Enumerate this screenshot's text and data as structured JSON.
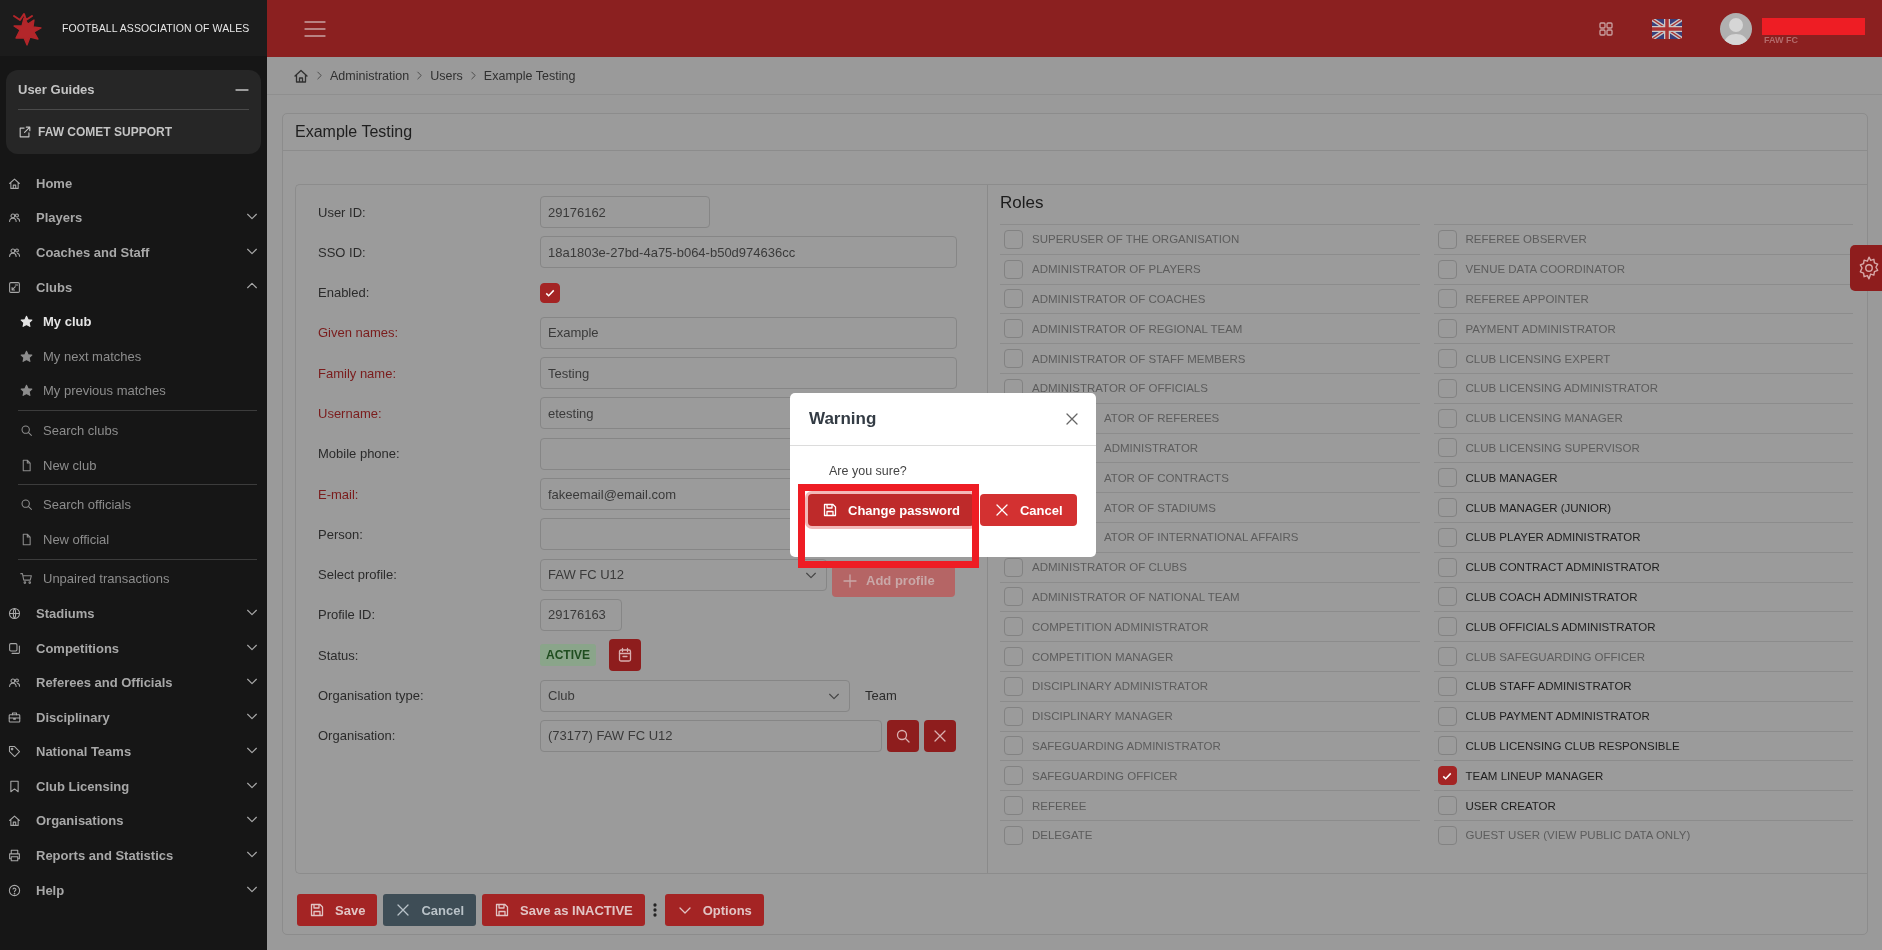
{
  "brand": {
    "name": "FOOTBALL ASSOCIATION OF WALES"
  },
  "header": {
    "org": "FAW FC"
  },
  "sidebar": {
    "guides": {
      "title": "User Guides",
      "link": "FAW COMET SUPPORT",
      "expanded": true
    },
    "items": [
      {
        "label": "Home",
        "kind": "link"
      },
      {
        "label": "Players",
        "kind": "group",
        "expanded": false
      },
      {
        "label": "Coaches and Staff",
        "kind": "group",
        "expanded": false
      },
      {
        "label": "Clubs",
        "kind": "group",
        "expanded": true,
        "children": [
          {
            "items": [
              {
                "label": "My club",
                "selected": true
              },
              {
                "label": "My next matches",
                "selected": false
              },
              {
                "label": "My previous matches",
                "selected": false
              }
            ]
          },
          {
            "items": [
              {
                "label": "Search clubs",
                "selected": false
              },
              {
                "label": "New club",
                "selected": false
              }
            ]
          },
          {
            "items": [
              {
                "label": "Search officials",
                "selected": false
              },
              {
                "label": "New official",
                "selected": false
              }
            ]
          },
          {
            "items": [
              {
                "label": "Unpaired transactions",
                "selected": false
              }
            ]
          }
        ]
      },
      {
        "label": "Stadiums",
        "kind": "group",
        "expanded": false
      },
      {
        "label": "Competitions",
        "kind": "group",
        "expanded": false
      },
      {
        "label": "Referees and Officials",
        "kind": "group",
        "expanded": false
      },
      {
        "label": "Disciplinary",
        "kind": "group",
        "expanded": false
      },
      {
        "label": "National Teams",
        "kind": "group",
        "expanded": false
      },
      {
        "label": "Club Licensing",
        "kind": "group",
        "expanded": false
      },
      {
        "label": "Organisations",
        "kind": "group",
        "expanded": false
      },
      {
        "label": "Reports and Statistics",
        "kind": "group",
        "expanded": false
      },
      {
        "label": "Help",
        "kind": "group",
        "expanded": false
      }
    ]
  },
  "breadcrumb": [
    "Administration",
    "Users",
    "Example Testing"
  ],
  "page": {
    "title": "Example Testing"
  },
  "form": {
    "fields": [
      {
        "label": "User ID:",
        "kind": "short",
        "required": false,
        "value": "29176162"
      },
      {
        "label": "SSO ID:",
        "kind": "text",
        "required": false,
        "value": "18a1803e-27bd-4a75-b064-b50d974636cc"
      },
      {
        "label": "Enabled:",
        "kind": "checkbox",
        "required": false,
        "checked": true
      },
      {
        "label": "Given names:",
        "kind": "text",
        "required": true,
        "value": "Example"
      },
      {
        "label": "Family name:",
        "kind": "text",
        "required": true,
        "value": "Testing"
      },
      {
        "label": "Username:",
        "kind": "text",
        "required": true,
        "value": "etesting"
      },
      {
        "label": "Mobile phone:",
        "kind": "text",
        "required": false
      },
      {
        "label": "E-mail:",
        "kind": "text",
        "required": true,
        "value": "fakeemail@email.com"
      },
      {
        "label": "Person:",
        "kind": "text",
        "required": false
      },
      {
        "label": "Select profile:",
        "kind": "profile",
        "required": false,
        "value": "FAW FC U12",
        "button": "Add profile"
      },
      {
        "label": "Profile ID:",
        "kind": "short",
        "required": false,
        "value": "29176163"
      },
      {
        "label": "Status:",
        "kind": "status",
        "required": false,
        "value": "ACTIVE"
      },
      {
        "label": "Organisation type:",
        "kind": "select",
        "required": false,
        "value": "Club",
        "aside": "Team"
      },
      {
        "label": "Organisation:",
        "kind": "lookup",
        "required": false,
        "value": "(73177) FAW FC U12"
      }
    ]
  },
  "roles": {
    "title": "Roles",
    "columns": [
      [
        {
          "label": "SUPERUSER OF THE ORGANISATION",
          "kind": "full",
          "checked": false,
          "disabled": true
        },
        {
          "label": "ADMINISTRATOR OF PLAYERS",
          "kind": "full",
          "checked": false,
          "disabled": true
        },
        {
          "label": "ADMINISTRATOR OF COACHES",
          "kind": "full",
          "checked": false,
          "disabled": true
        },
        {
          "label": "ADMINISTRATOR OF REGIONAL TEAM",
          "kind": "full",
          "checked": false,
          "disabled": true
        },
        {
          "label": "ADMINISTRATOR OF STAFF MEMBERS",
          "kind": "full",
          "checked": false,
          "disabled": true
        },
        {
          "label": "ADMINISTRATOR OF OFFICIALS",
          "kind": "full",
          "checked": false,
          "disabled": true
        },
        {
          "label": "ATOR OF REFEREES",
          "kind": "covered",
          "disabled": true
        },
        {
          "label": "ADMINISTRATOR",
          "kind": "covered",
          "disabled": true
        },
        {
          "label": "ATOR OF CONTRACTS",
          "kind": "covered",
          "disabled": true
        },
        {
          "label": "ATOR OF STADIUMS",
          "kind": "covered",
          "disabled": true
        },
        {
          "label": "ATOR OF INTERNATIONAL AFFAIRS",
          "kind": "covered",
          "disabled": true
        },
        {
          "label": "ADMINISTRATOR OF CLUBS",
          "kind": "full",
          "checked": false,
          "disabled": true
        },
        {
          "label": "ADMINISTRATOR OF NATIONAL TEAM",
          "kind": "full",
          "checked": false,
          "disabled": true
        },
        {
          "label": "COMPETITION ADMINISTRATOR",
          "kind": "full",
          "checked": false,
          "disabled": true
        },
        {
          "label": "COMPETITION MANAGER",
          "kind": "full",
          "checked": false,
          "disabled": true
        },
        {
          "label": "DISCIPLINARY ADMINISTRATOR",
          "kind": "full",
          "checked": false,
          "disabled": true
        },
        {
          "label": "DISCIPLINARY MANAGER",
          "kind": "full",
          "checked": false,
          "disabled": true
        },
        {
          "label": "SAFEGUARDING ADMINISTRATOR",
          "kind": "full",
          "checked": false,
          "disabled": true
        },
        {
          "label": "SAFEGUARDING OFFICER",
          "kind": "full",
          "checked": false,
          "disabled": true
        },
        {
          "label": "REFEREE",
          "kind": "full",
          "checked": false,
          "disabled": true
        },
        {
          "label": "DELEGATE",
          "kind": "full",
          "checked": false,
          "disabled": true
        }
      ],
      [
        {
          "label": "REFEREE OBSERVER",
          "kind": "full",
          "checked": false,
          "disabled": true
        },
        {
          "label": "VENUE DATA COORDINATOR",
          "kind": "full",
          "checked": false,
          "disabled": true
        },
        {
          "label": "REFEREE APPOINTER",
          "kind": "full",
          "checked": false,
          "disabled": true
        },
        {
          "label": "PAYMENT ADMINISTRATOR",
          "kind": "full",
          "checked": false,
          "disabled": true
        },
        {
          "label": "CLUB LICENSING EXPERT",
          "kind": "full",
          "checked": false,
          "disabled": true
        },
        {
          "label": "CLUB LICENSING ADMINISTRATOR",
          "kind": "full",
          "checked": false,
          "disabled": true
        },
        {
          "label": "CLUB LICENSING MANAGER",
          "kind": "full",
          "checked": false,
          "disabled": true
        },
        {
          "label": "CLUB LICENSING SUPERVISOR",
          "kind": "full",
          "checked": false,
          "disabled": true
        },
        {
          "label": "CLUB MANAGER",
          "kind": "full",
          "checked": false,
          "disabled": false
        },
        {
          "label": "CLUB MANAGER (JUNIOR)",
          "kind": "full",
          "checked": false,
          "disabled": false
        },
        {
          "label": "CLUB PLAYER ADMINISTRATOR",
          "kind": "full",
          "checked": false,
          "disabled": false
        },
        {
          "label": "CLUB CONTRACT ADMINISTRATOR",
          "kind": "full",
          "checked": false,
          "disabled": false
        },
        {
          "label": "CLUB COACH ADMINISTRATOR",
          "kind": "full",
          "checked": false,
          "disabled": false
        },
        {
          "label": "CLUB OFFICIALS ADMINISTRATOR",
          "kind": "full",
          "checked": false,
          "disabled": false
        },
        {
          "label": "CLUB SAFEGUARDING OFFICER",
          "kind": "full",
          "checked": false,
          "disabled": true
        },
        {
          "label": "CLUB STAFF ADMINISTRATOR",
          "kind": "full",
          "checked": false,
          "disabled": false
        },
        {
          "label": "CLUB PAYMENT ADMINISTRATOR",
          "kind": "full",
          "checked": false,
          "disabled": false
        },
        {
          "label": "CLUB LICENSING CLUB RESPONSIBLE",
          "kind": "full",
          "checked": false,
          "disabled": false
        },
        {
          "label": "TEAM LINEUP MANAGER",
          "kind": "full",
          "checked": true,
          "disabled": false
        },
        {
          "label": "USER CREATOR",
          "kind": "full",
          "checked": false,
          "disabled": false
        },
        {
          "label": "GUEST USER (VIEW PUBLIC DATA ONLY)",
          "kind": "full",
          "checked": false,
          "disabled": true
        }
      ]
    ]
  },
  "actions": [
    {
      "label": "Save",
      "kind": "save"
    },
    {
      "label": "Cancel",
      "kind": "cancel"
    },
    {
      "label": "Save as INACTIVE",
      "kind": "save"
    },
    {
      "kind": "more"
    },
    {
      "label": "Options",
      "kind": "menu"
    }
  ],
  "modal": {
    "title": "Warning",
    "message": "Are you sure?",
    "buttons": [
      {
        "label": "Change password",
        "kind": "primary",
        "highlighted": true
      },
      {
        "label": "Cancel",
        "kind": "cancel",
        "highlighted": false
      }
    ]
  }
}
